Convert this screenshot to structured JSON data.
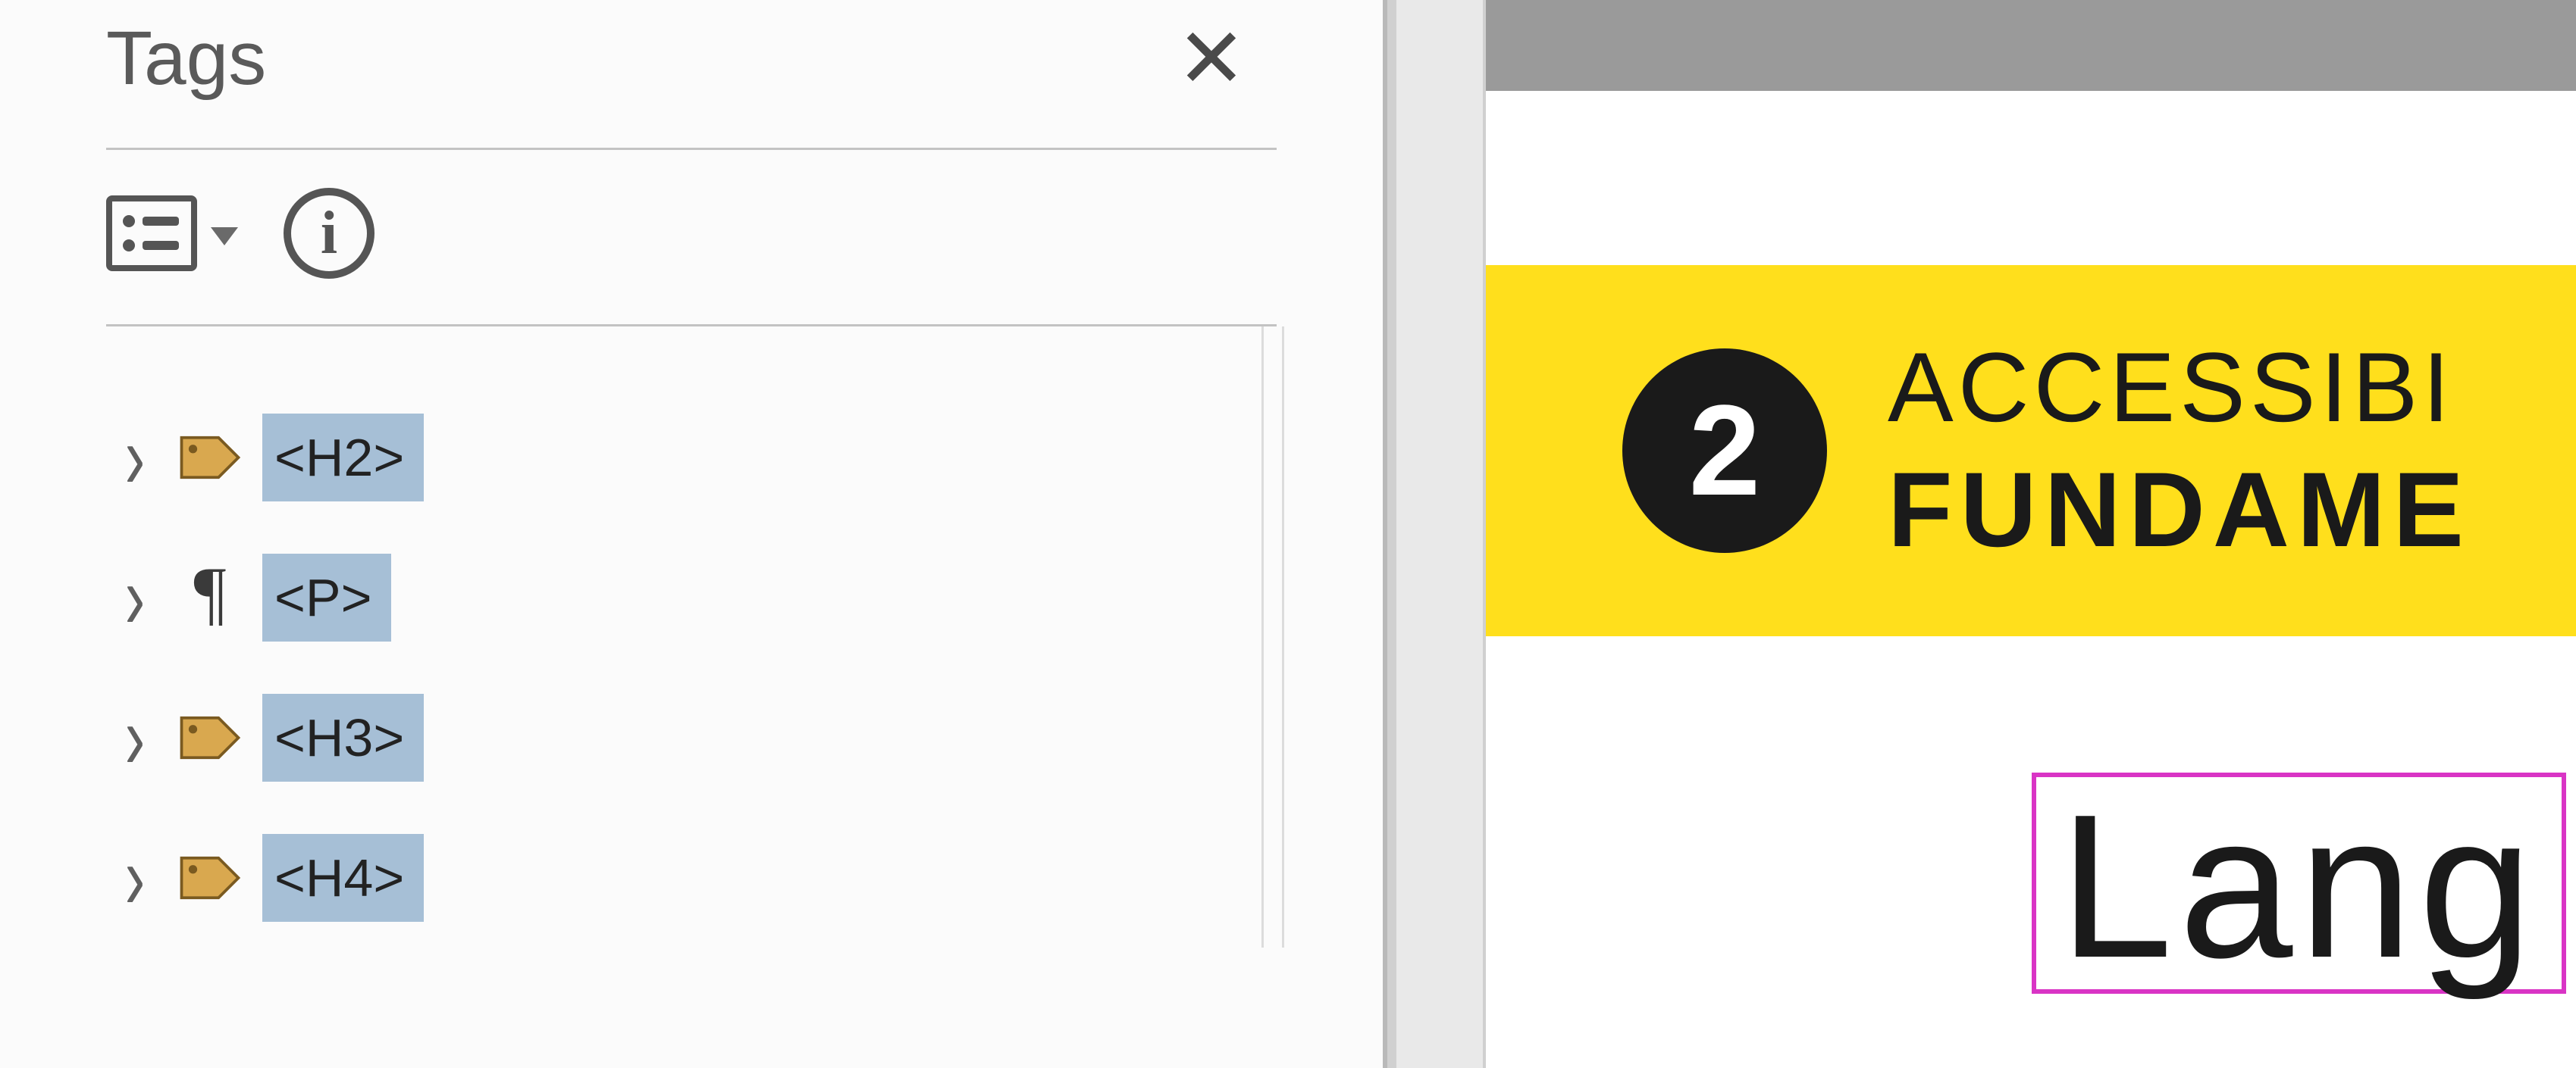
{
  "panel": {
    "title": "Tags",
    "close_glyph": "✕",
    "toolbar": {
      "options_name": "options-menu",
      "info_name": "info-button",
      "info_glyph": "i"
    }
  },
  "tree": {
    "items": [
      {
        "label": "<H2>",
        "icon": "tag"
      },
      {
        "label": "<P>",
        "icon": "paragraph"
      },
      {
        "label": "<H3>",
        "icon": "tag"
      },
      {
        "label": "<H4>",
        "icon": "tag"
      }
    ],
    "chevron_glyph": "›",
    "paragraph_glyph": "¶"
  },
  "document": {
    "badge_number": "2",
    "banner_line1": "ACCESSIBI",
    "banner_line2": "FUNDAME",
    "heading_fragment": "Lang",
    "colors": {
      "banner_bg": "#ffdf1c",
      "badge_bg": "#1a1a1a",
      "selection_border": "#d934c5",
      "tag_highlight": "#a6bfd6"
    }
  }
}
